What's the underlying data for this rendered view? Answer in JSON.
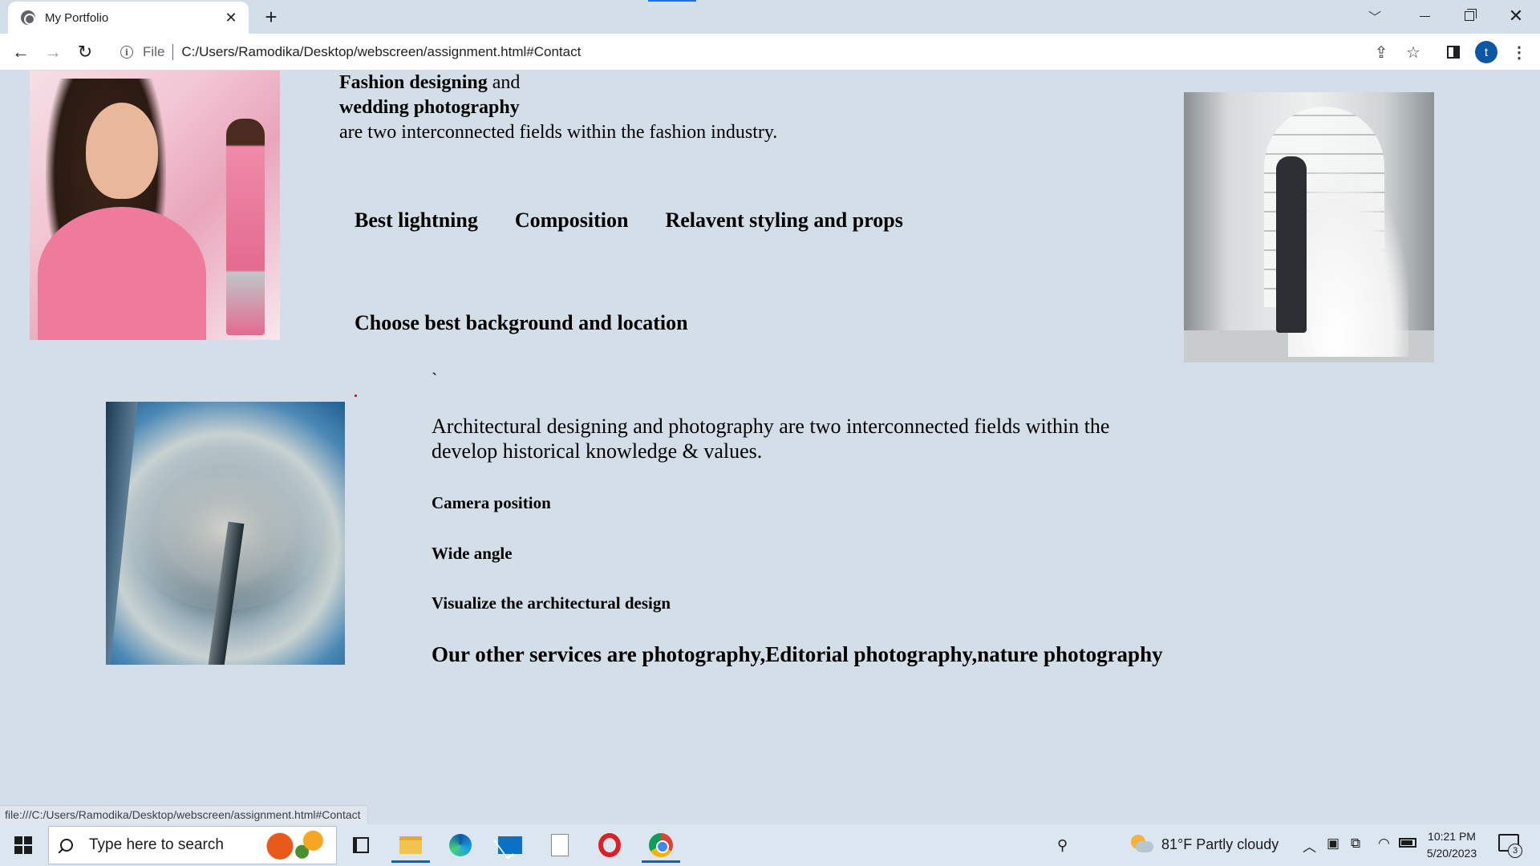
{
  "browser": {
    "tab_title": "My Portfolio",
    "url_scheme": "File",
    "url": "C:/Users/Ramodika/Desktop/webscreen/assignment.html#Contact",
    "profile_initial": "t",
    "status_url": "file:///C:/Users/Ramodika/Desktop/webscreen/assignment.html#Contact",
    "icons": [
      "globe-icon",
      "close-icon",
      "plus-icon",
      "chevron-down-icon",
      "minimize-icon",
      "maximize-icon",
      "close-window-icon",
      "back-arrow-icon",
      "forward-arrow-icon",
      "reload-icon",
      "info-icon",
      "share-icon",
      "star-icon",
      "side-panel-icon",
      "kebab-menu-icon"
    ]
  },
  "page": {
    "intro_bold_1": "Fashion designing",
    "intro_and": "and",
    "intro_bold_2": "wedding photography",
    "intro_line_3": "are two interconnected fields within the fashion industry.",
    "services": [
      "Best lightning",
      "Composition",
      "Relavent styling and props"
    ],
    "choose": "Choose best background and location",
    "tick": "`",
    "arch_paragraph": "Architectural designing and photography are two interconnected fields within the develop historical knowledge & values.",
    "arch_items": [
      "Camera position",
      "Wide angle",
      "Visualize the architectural design"
    ],
    "other_services": "Our other services are photography,Editorial photography,nature photography"
  },
  "taskbar": {
    "search_placeholder": "Type here to search",
    "weather": "81°F  Partly cloudy",
    "time": "10:21 PM",
    "date": "5/20/2023",
    "notification_count": "3",
    "apps": [
      "task-view",
      "file-explorer",
      "edge",
      "mail",
      "file",
      "opera",
      "chrome"
    ]
  }
}
